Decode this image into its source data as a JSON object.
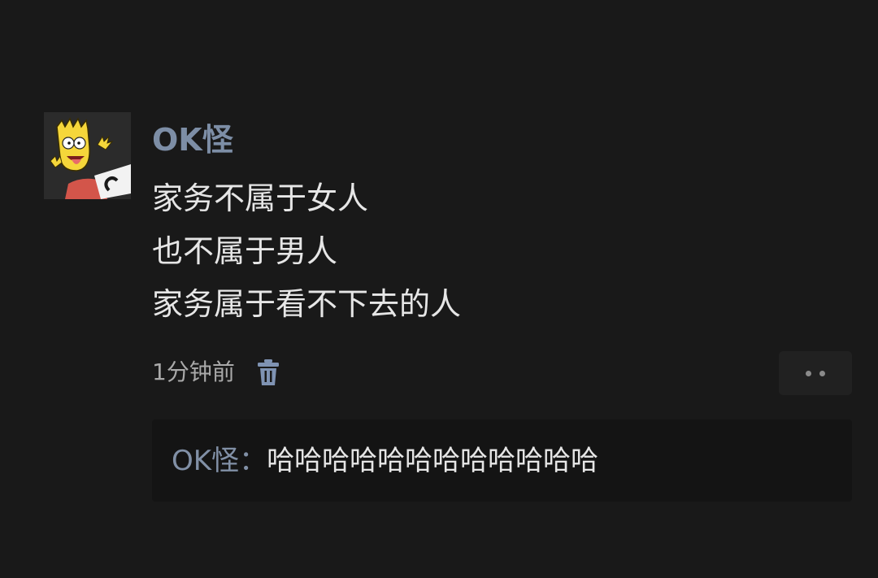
{
  "post": {
    "author": "OK怪",
    "lines": [
      "家务不属于女人",
      "也不属于男人",
      "家务属于看不下去的人"
    ],
    "time": "1分钟前"
  },
  "comment": {
    "author": "OK怪",
    "separator": "：",
    "text": "哈哈哈哈哈哈哈哈哈哈哈哈"
  },
  "icons": {
    "avatar": "cartoon-avatar",
    "delete": "trash-icon",
    "more": "more-dots-icon"
  },
  "colors": {
    "background": "#191919",
    "username": "#7d8ea6",
    "text": "#e6e6e6",
    "meta": "#a9a9a9",
    "trash": "#7f93b3"
  }
}
